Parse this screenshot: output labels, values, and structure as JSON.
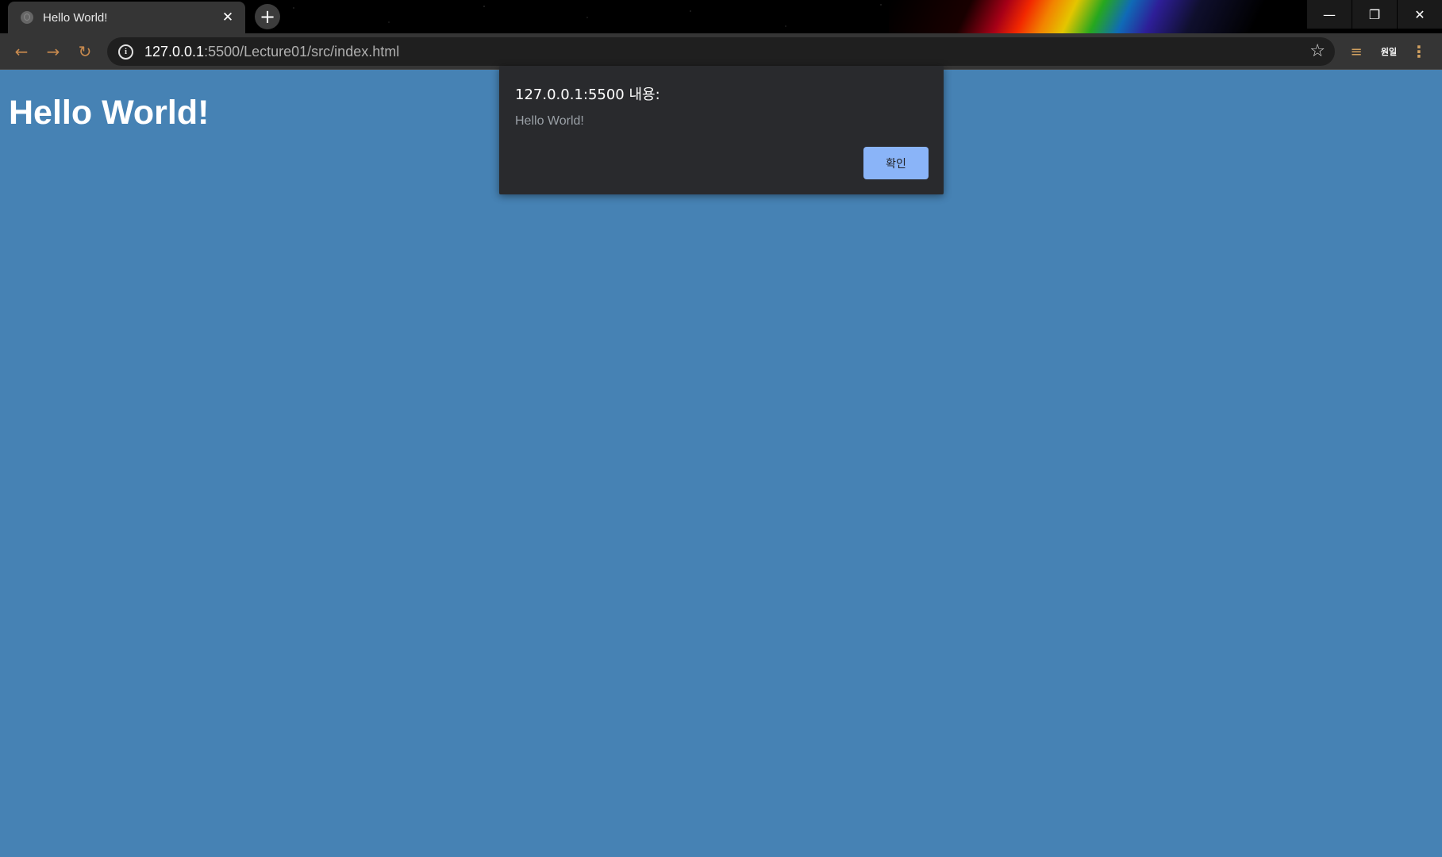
{
  "browser": {
    "tab": {
      "title": "Hello World!",
      "close_glyph": "✕",
      "favicon": "globe-icon"
    },
    "new_tab_glyph": "+",
    "window_controls": {
      "minimize_glyph": "—",
      "restore_glyph": "❐",
      "close_glyph": "✕"
    },
    "toolbar": {
      "back_glyph": "←",
      "forward_glyph": "→",
      "reload_glyph": "↻",
      "url_host": "127.0.0.1",
      "url_rest": ":5500/Lecture01/src/index.html",
      "info_glyph": "i",
      "bookmark_glyph": "☆",
      "reading_list_glyph": "≡",
      "translate_label": "원일",
      "menu_glyph": "⋮"
    }
  },
  "page": {
    "heading": "Hello World!",
    "background_color": "#4682b4"
  },
  "dialog": {
    "title": "127.0.0.1:5500 내용:",
    "message": "Hello World!",
    "ok_label": "확인",
    "button_color": "#8ab4f8"
  }
}
